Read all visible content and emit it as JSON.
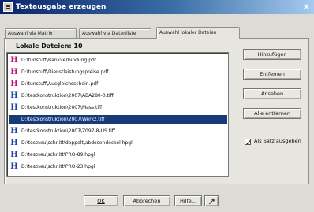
{
  "window": {
    "title": "Textausgabe erzeugen",
    "close_glyph": "x"
  },
  "tabs": [
    {
      "label": "Auswahl via Matrix",
      "active": false
    },
    {
      "label": "Auswahl via Datenliste",
      "active": false
    },
    {
      "label": "Auswahl lokaler Dateien",
      "active": true
    }
  ],
  "list": {
    "title": "Lokale Dateien: 10",
    "items": [
      {
        "name": "D:\\tunstuff\\Bankverbindung.pdf",
        "icon": "pdf-icon",
        "selected": false
      },
      {
        "name": "D:\\tunstuff\\Dienstleistungspreise.pdf",
        "icon": "pdf-icon",
        "selected": false
      },
      {
        "name": "D:\\tunstuff\\Ausgleichsschein.pdf",
        "icon": "pdf-icon",
        "selected": false
      },
      {
        "name": "D:\\testkonstruktion\\2007\\ABA280-0.tiff",
        "icon": "tiff-icon",
        "selected": false
      },
      {
        "name": "D:\\testkonstruktion\\2007\\Mass.tiff",
        "icon": "tiff-icon",
        "selected": false
      },
      {
        "name": "D:\\testkonstruktion\\2007\\Werkz.tiff",
        "icon": "tiff-icon",
        "selected": true
      },
      {
        "name": "D:\\testkonstruktion\\2007\\Z097-8-US.tiff",
        "icon": "tiff-icon",
        "selected": false
      },
      {
        "name": "D:\\testneu\\schnitt\\doppelt\\abdosendeckel.hpgl",
        "icon": "hpgl-icon",
        "selected": false
      },
      {
        "name": "D:\\testneu\\schnitt\\PRO-89.hpgl",
        "icon": "hpgl-icon",
        "selected": false
      },
      {
        "name": "D:\\testneu\\schnitt\\PRO-23.hpgl",
        "icon": "hpgl-icon",
        "selected": false
      }
    ]
  },
  "buttons": {
    "add": "Hinzufügen",
    "remove": "Entfernen",
    "view": "Ansehen",
    "remove_all": "Alle entfernen"
  },
  "option": {
    "label": "Als Satz ausgeben",
    "checked": true
  },
  "footer": {
    "ok": "OK",
    "cancel": "Abbrechen",
    "help": "Hilfe...",
    "tool_icon": "tool-icon"
  },
  "colors": {
    "title_bar": "#0a246a",
    "selection": "#173a78",
    "pdf_icon": "#c0107a",
    "tiff_icon": "#1c3fa8"
  }
}
